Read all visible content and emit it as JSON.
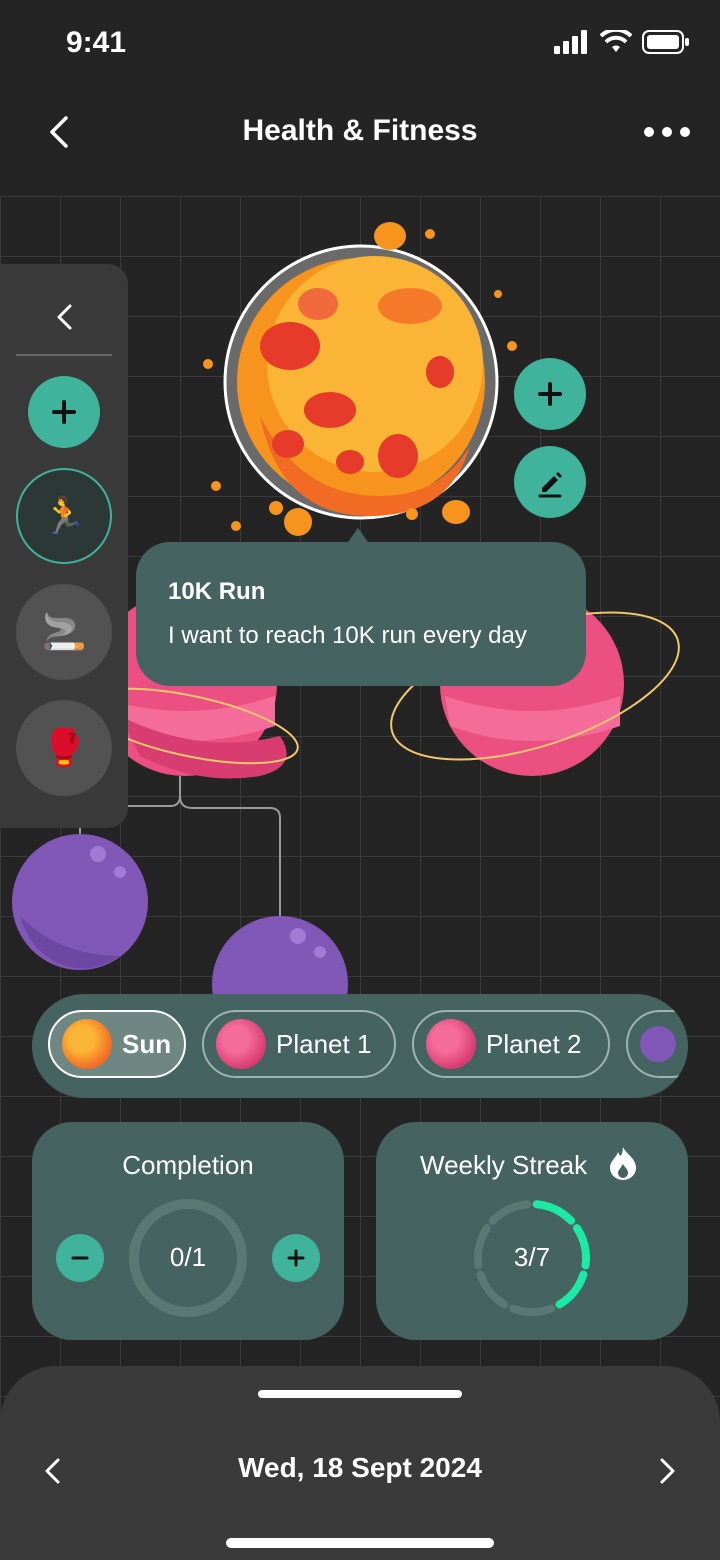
{
  "status": {
    "time": "9:41"
  },
  "header": {
    "title": "Health & Fitness"
  },
  "tooltip": {
    "title": "10K Run",
    "description": "I want to reach 10K run every day"
  },
  "habits": [
    {
      "icon": "🏃",
      "name": "running"
    },
    {
      "icon": "🚬",
      "name": "smoking"
    },
    {
      "icon": "🥊",
      "name": "boxing"
    }
  ],
  "chips": [
    {
      "label": "Sun"
    },
    {
      "label": "Planet 1"
    },
    {
      "label": "Planet 2"
    }
  ],
  "completion": {
    "title": "Completion",
    "value": "0/1",
    "progress": 0
  },
  "streak": {
    "title": "Weekly Streak",
    "value": "3/7",
    "progress": 0.4286
  },
  "footer": {
    "date": "Wed, 18 Sept 2024"
  },
  "colors": {
    "accent": "#3fb39c",
    "card": "#456361",
    "streak": "#1de9a6",
    "sun": "#f7941d"
  }
}
